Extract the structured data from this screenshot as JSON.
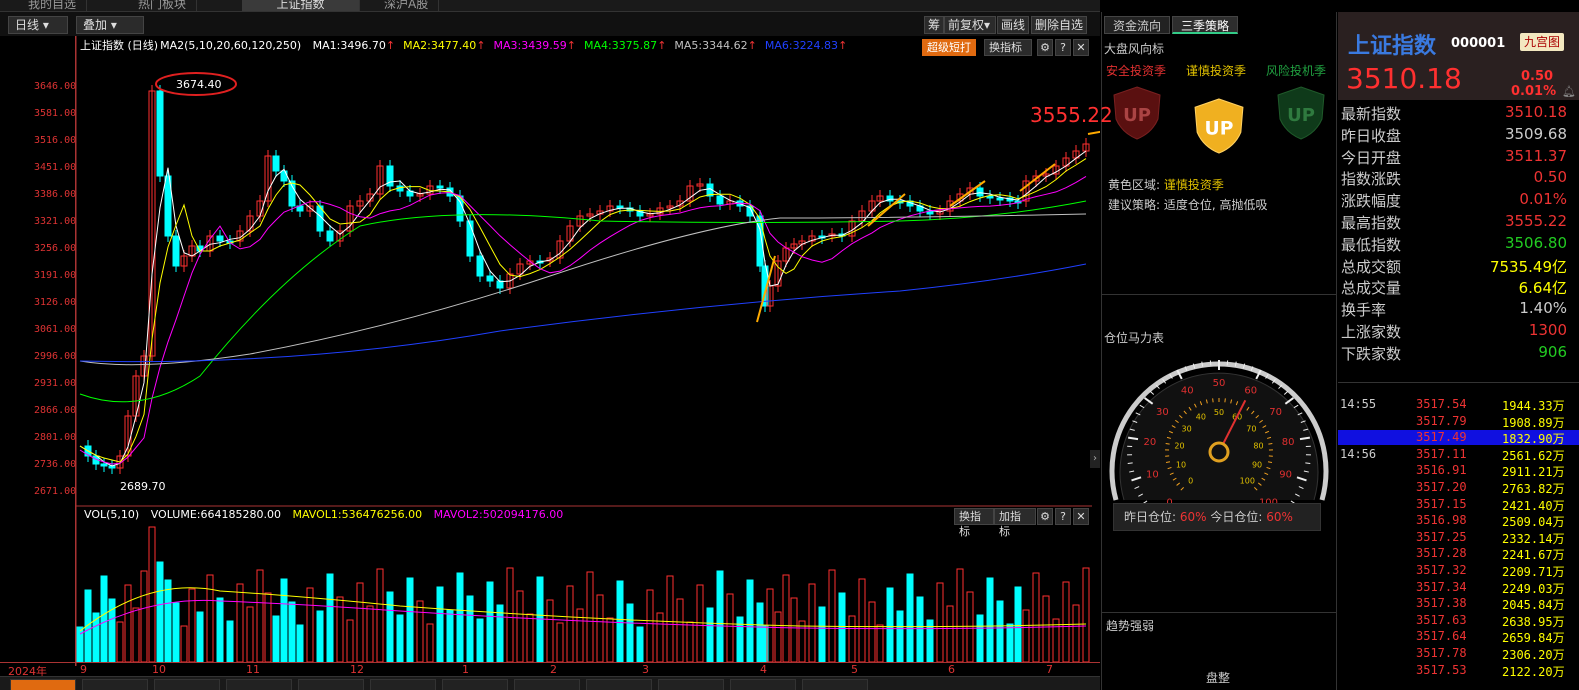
{
  "top_tabs": [
    "我的自选",
    "热门板块",
    "上证指数",
    "深沪A股"
  ],
  "toolbar": {
    "period": "日线",
    "overlay": "叠加",
    "right_buttons": [
      "筹",
      "前复权",
      "画线",
      "删除自选"
    ]
  },
  "chart_header": {
    "title": "上证指数 (日线)",
    "ma_params": "MA2(5,10,20,60,120,250)",
    "ma": [
      {
        "label": "MA1:3496.70",
        "color": "#ffffff"
      },
      {
        "label": "MA2:3477.40",
        "color": "#ffff00"
      },
      {
        "label": "MA3:3439.59",
        "color": "#ff00ff"
      },
      {
        "label": "MA4:3375.87",
        "color": "#00ff00"
      },
      {
        "label": "MA5:3344.62",
        "color": "#c0c0c0"
      },
      {
        "label": "MA6:3224.83",
        "color": "#2040ff"
      }
    ],
    "btn_super": "超级短打",
    "btn_switch": "换指标"
  },
  "annotations": {
    "high_label": "3674.40",
    "low_label": "2689.70",
    "peak_label": "3555.22"
  },
  "y_ticks": [
    "3646.00",
    "3581.00",
    "3516.00",
    "3451.00",
    "3386.00",
    "3321.00",
    "3256.00",
    "3191.00",
    "3126.00",
    "3061.00",
    "2996.00",
    "2931.00",
    "2866.00",
    "2801.00",
    "2736.00",
    "2671.00"
  ],
  "volume_header": {
    "title": "VOL(5,10)",
    "volume": "VOLUME:664185280.00",
    "mavol1": "MAVOL1:536476256.00",
    "mavol2": "MAVOL2:502094176.00",
    "btn_switch": "换指标",
    "btn_add": "加指标"
  },
  "x_ticks": [
    "2024年",
    "9",
    "10",
    "11",
    "12",
    "1",
    "2",
    "3",
    "4",
    "5",
    "6",
    "7"
  ],
  "side_tabs": [
    "资金流向",
    "三季策略"
  ],
  "strategy": {
    "title": "大盘风向标",
    "seasons": [
      {
        "label": "安全投资季",
        "color": "#e03030"
      },
      {
        "label": "谨慎投资季",
        "color": "#e0c000"
      },
      {
        "label": "风险投机季",
        "color": "#20a040"
      }
    ],
    "zone_label": "黄色区域:",
    "zone_value": "谨慎投资季",
    "advice": "建议策略: 适度仓位, 高抛低吸"
  },
  "gauge": {
    "title": "仓位马力表",
    "outer_ticks": [
      "0",
      "10",
      "20",
      "30",
      "40",
      "50",
      "60",
      "70",
      "80",
      "90",
      "100"
    ],
    "yesterday_label": "昨日仓位:",
    "yesterday_value": "60%",
    "today_label": "今日仓位:",
    "today_value": "60%",
    "position": 0.6
  },
  "trend": {
    "title": "趋势强弱",
    "status": "盘整"
  },
  "index": {
    "name": "上证指数",
    "code": "000001",
    "badge": "九宫图",
    "price": "3510.18",
    "change": "0.50",
    "pct": "0.01%"
  },
  "stats": [
    {
      "label": "最新指数",
      "value": "3510.18",
      "color": "#e33"
    },
    {
      "label": "昨日收盘",
      "value": "3509.68",
      "color": "#ccc"
    },
    {
      "label": "今日开盘",
      "value": "3511.37",
      "color": "#e33"
    },
    {
      "label": "指数涨跌",
      "value": "0.50",
      "color": "#e33"
    },
    {
      "label": "涨跌幅度",
      "value": "0.01%",
      "color": "#e33"
    },
    {
      "label": "最高指数",
      "value": "3555.22",
      "color": "#e33"
    },
    {
      "label": "最低指数",
      "value": "3506.80",
      "color": "#2c2"
    },
    {
      "label": "总成交额",
      "value": "7535.49亿",
      "color": "#ff0"
    },
    {
      "label": "总成交量",
      "value": "6.64亿",
      "color": "#ff0"
    },
    {
      "label": "换手率",
      "value": "1.40%",
      "color": "#ccc"
    },
    {
      "label": "上涨家数",
      "value": "1300",
      "color": "#e33"
    },
    {
      "label": "下跌家数",
      "value": "906",
      "color": "#2c2"
    }
  ],
  "ticks": [
    {
      "time": "14:55",
      "price": "3517.54",
      "amount": "1944.33万"
    },
    {
      "time": "",
      "price": "3517.79",
      "amount": "1908.89万"
    },
    {
      "time": "",
      "price": "3517.49",
      "amount": "1832.90万",
      "selected": true
    },
    {
      "time": "14:56",
      "price": "3517.11",
      "amount": "2561.62万"
    },
    {
      "time": "",
      "price": "3516.91",
      "amount": "2911.21万"
    },
    {
      "time": "",
      "price": "3517.20",
      "amount": "2763.82万"
    },
    {
      "time": "",
      "price": "3517.15",
      "amount": "2421.40万"
    },
    {
      "time": "",
      "price": "3516.98",
      "amount": "2509.04万"
    },
    {
      "time": "",
      "price": "3517.25",
      "amount": "2332.14万"
    },
    {
      "time": "",
      "price": "3517.28",
      "amount": "2241.67万"
    },
    {
      "time": "",
      "price": "3517.32",
      "amount": "2209.71万"
    },
    {
      "time": "",
      "price": "3517.34",
      "amount": "2249.03万"
    },
    {
      "time": "",
      "price": "3517.38",
      "amount": "2045.84万"
    },
    {
      "time": "",
      "price": "3517.63",
      "amount": "2638.95万"
    },
    {
      "time": "",
      "price": "3517.64",
      "amount": "2659.84万"
    },
    {
      "time": "",
      "price": "3517.78",
      "amount": "2306.20万"
    },
    {
      "time": "",
      "price": "3517.53",
      "amount": "2122.20万"
    }
  ],
  "colors": {
    "up": "#ff3030",
    "down": "#00ffff",
    "accent": "#e06a10"
  }
}
